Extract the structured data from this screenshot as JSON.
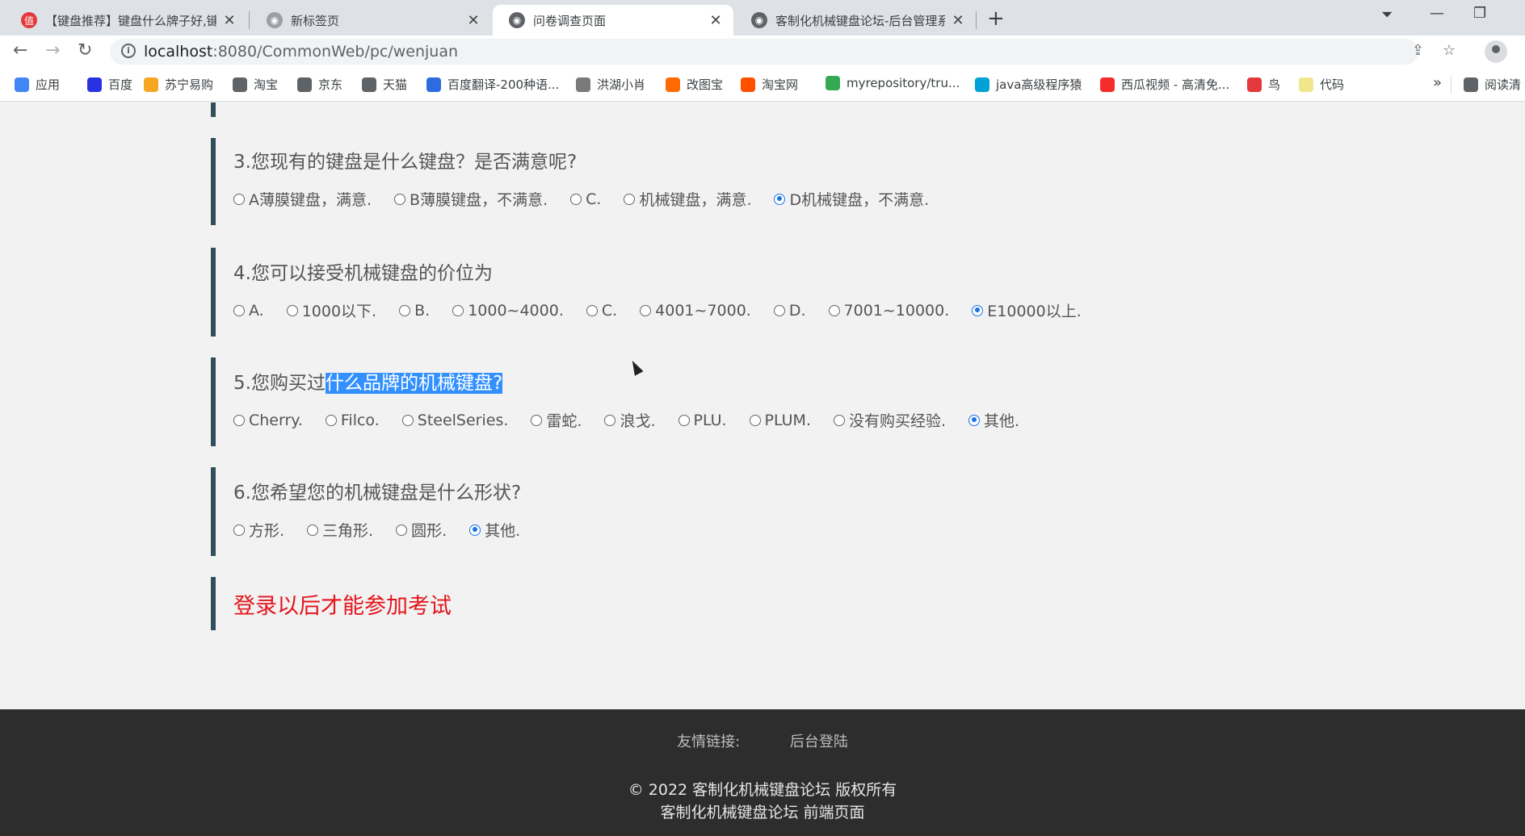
{
  "tabs": [
    {
      "title": "【键盘推荐】键盘什么牌子好,键盘",
      "icon": "值",
      "color": "#e4393c"
    },
    {
      "title": "新标签页",
      "icon": "",
      "color": "#5f6368"
    },
    {
      "title": "问卷调查页面",
      "icon": "",
      "color": "#5f6368"
    },
    {
      "title": "客制化机械键盘论坛-后台管理系",
      "icon": "",
      "color": "#5f6368"
    }
  ],
  "address": {
    "host": "localhost",
    "rest": ":8080/CommonWeb/pc/wenjuan"
  },
  "bookmarks": [
    {
      "label": "应用",
      "color": "#4285f4"
    },
    {
      "label": "百度",
      "color": "#2932e1"
    },
    {
      "label": "苏宁易购",
      "color": "#f5a623"
    },
    {
      "label": "淘宝",
      "color": "#5f6368"
    },
    {
      "label": "京东",
      "color": "#5f6368"
    },
    {
      "label": "天猫",
      "color": "#5f6368"
    },
    {
      "label": "百度翻译-200种语...",
      "color": "#2d6cdf"
    },
    {
      "label": "洪湖小肖",
      "color": "#7a7a7a"
    },
    {
      "label": "改图宝",
      "color": "#ff6a00"
    },
    {
      "label": "淘宝网",
      "color": "#ff5000"
    },
    {
      "label": "myrepository/tru...",
      "color": "#34a853"
    },
    {
      "label": "java高级程序猿",
      "color": "#00a1d6"
    },
    {
      "label": "西瓜视频 - 高清免...",
      "color": "#f42c2c"
    },
    {
      "label": "鸟",
      "color": "#e4393c"
    },
    {
      "label": "代码",
      "color": "#f0e68c"
    },
    {
      "label": "阅读清",
      "color": "#5f6368"
    }
  ],
  "questions": [
    {
      "title": "3.您现有的键盘是什么键盘？是否满意呢?",
      "options": [
        "A薄膜键盘，满意.",
        "B薄膜键盘，不满意.",
        "C.",
        "机械键盘，满意.",
        "D机械键盘，不满意."
      ],
      "selected": 4
    },
    {
      "title": "4.您可以接受机械键盘的价位为",
      "options": [
        "A.",
        "1000以下.",
        "B.",
        "1000~4000.",
        "C.",
        "4001~7000.",
        "D.",
        "7001~10000.",
        "E10000以上."
      ],
      "selected": 8
    },
    {
      "title_pre": "5.您购买过",
      "title_hl": "什么品牌的机械键盘?",
      "options": [
        "Cherry.",
        "Filco.",
        "SteelSeries.",
        "雷蛇.",
        "浪戈.",
        "PLU.",
        "PLUM.",
        "没有购买经验.",
        "其他."
      ],
      "selected": 8
    },
    {
      "title": "6.您希望您的机械键盘是什么形状?",
      "options": [
        "方形.",
        "三角形.",
        "圆形.",
        "其他."
      ],
      "selected": 3
    }
  ],
  "login_tip": "登录以后才能参加考试",
  "footer": {
    "links_label": "友情链接:",
    "admin_link": "后台登陆",
    "copyright": "© 2022 客制化机械键盘论坛 版权所有",
    "subtitle": "客制化机械键盘论坛 前端页面"
  }
}
